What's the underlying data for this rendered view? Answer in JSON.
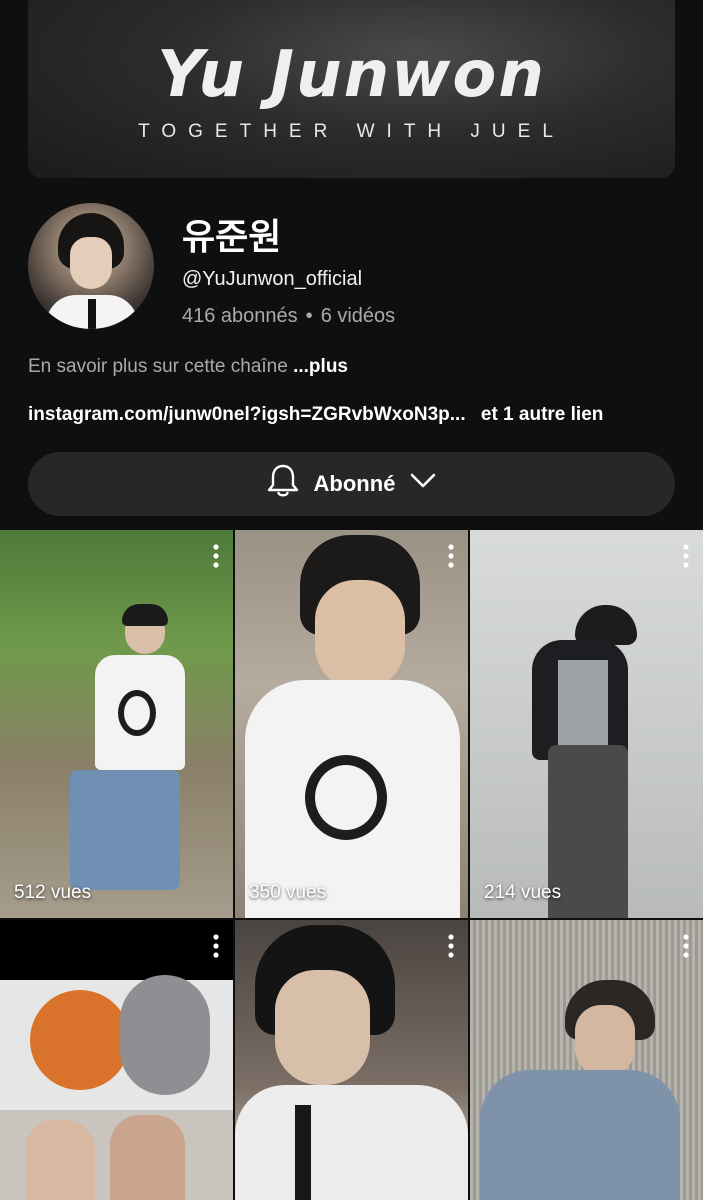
{
  "banner": {
    "title": "Yu Junwon",
    "subtitle": "TOGETHER WITH JUEL"
  },
  "channel": {
    "name": "유준원",
    "handle": "@YuJunwon_official",
    "subscribers": "416 abonnés",
    "separator": "•",
    "videos": "6 vidéos",
    "about": "En savoir plus sur cette chaîne",
    "about_more": "...plus",
    "link": "instagram.com/junw0nel?igsh=ZGRvbWxoN3p...",
    "link_extra": "et 1 autre lien"
  },
  "subscribe_button": {
    "label": "Abonné",
    "icon": "bell-icon",
    "caret_icon": "chevron-down-icon"
  },
  "videos": [
    {
      "views": "512 vues"
    },
    {
      "views": "350 vues"
    },
    {
      "views": "214 vues"
    },
    {
      "views": ""
    },
    {
      "views": ""
    },
    {
      "views": ""
    }
  ]
}
